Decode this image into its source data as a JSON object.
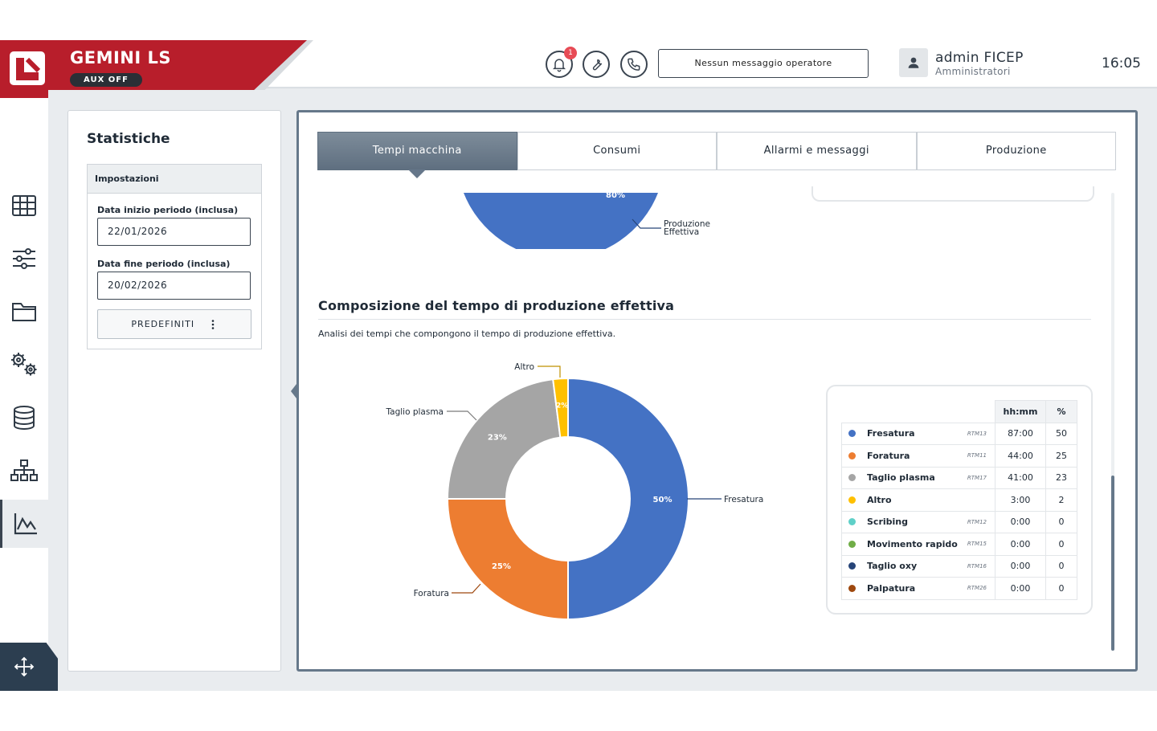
{
  "header": {
    "brand_name": "GEMINI LS",
    "aux_status": "AUX OFF",
    "notification_count": "1",
    "operator_message": "Nessun messaggio operatore",
    "user_name": "admin FICEP",
    "user_role": "Amministratori",
    "clock": "16:05"
  },
  "sidebar": {
    "items": [
      {
        "icon": "grid-icon"
      },
      {
        "icon": "sliders-icon"
      },
      {
        "icon": "folder-icon"
      },
      {
        "icon": "gears-icon"
      },
      {
        "icon": "database-icon"
      },
      {
        "icon": "hierarchy-icon"
      },
      {
        "icon": "chart-icon",
        "active": true
      }
    ],
    "move_icon": "move-arrows-icon"
  },
  "settings_panel": {
    "title": "Statistiche",
    "section_title": "Impostazioni",
    "start_label": "Data inizio periodo (inclusa)",
    "start_value": "22/01/2026",
    "end_label": "Data fine periodo (inclusa)",
    "end_value": "20/02/2026",
    "preset_button": "PREDEFINITI",
    "preset_icon": "kebab-menu-icon"
  },
  "tabs": [
    {
      "label": "Tempi macchina",
      "active": true
    },
    {
      "label": "Consumi",
      "active": false
    },
    {
      "label": "Allarmi e messaggi",
      "active": false
    },
    {
      "label": "Produzione",
      "active": false
    }
  ],
  "previous_chart": {
    "slice_label": "80%",
    "callout": [
      "Produzione",
      "Effettiva"
    ],
    "color": "#4472c4"
  },
  "section": {
    "title": "Composizione del tempo di produzione effettiva",
    "subtitle": "Analisi dei tempi che compongono il tempo di produzione effettiva."
  },
  "chart_data": {
    "type": "pie",
    "donut": true,
    "categories": [
      "Fresatura",
      "Foratura",
      "Taglio plasma",
      "Altro"
    ],
    "values": [
      50,
      25,
      23,
      2
    ],
    "slice_labels": [
      "50%",
      "25%",
      "23%",
      "2%"
    ],
    "colors": [
      "#4472c4",
      "#ed7d31",
      "#a5a5a5",
      "#ffc000"
    ]
  },
  "legend_table": {
    "headers": [
      "",
      "hh:mm",
      "%"
    ],
    "rows": [
      {
        "name": "Fresatura",
        "code": "RTM13",
        "time": "87:00",
        "pct": "50",
        "color": "#4472c4"
      },
      {
        "name": "Foratura",
        "code": "RTM11",
        "time": "44:00",
        "pct": "25",
        "color": "#ed7d31"
      },
      {
        "name": "Taglio plasma",
        "code": "RTM17",
        "time": "41:00",
        "pct": "23",
        "color": "#a5a5a5"
      },
      {
        "name": "Altro",
        "code": "",
        "time": "3:00",
        "pct": "2",
        "color": "#ffc000"
      },
      {
        "name": "Scribing",
        "code": "RTM12",
        "time": "0:00",
        "pct": "0",
        "color": "#5fd0c8"
      },
      {
        "name": "Movimento rapido",
        "code": "RTM15",
        "time": "0:00",
        "pct": "0",
        "color": "#70ad47"
      },
      {
        "name": "Taglio oxy",
        "code": "RTM16",
        "time": "0:00",
        "pct": "0",
        "color": "#264478"
      },
      {
        "name": "Palpatura",
        "code": "RTM26",
        "time": "0:00",
        "pct": "0",
        "color": "#9e480e"
      }
    ]
  }
}
